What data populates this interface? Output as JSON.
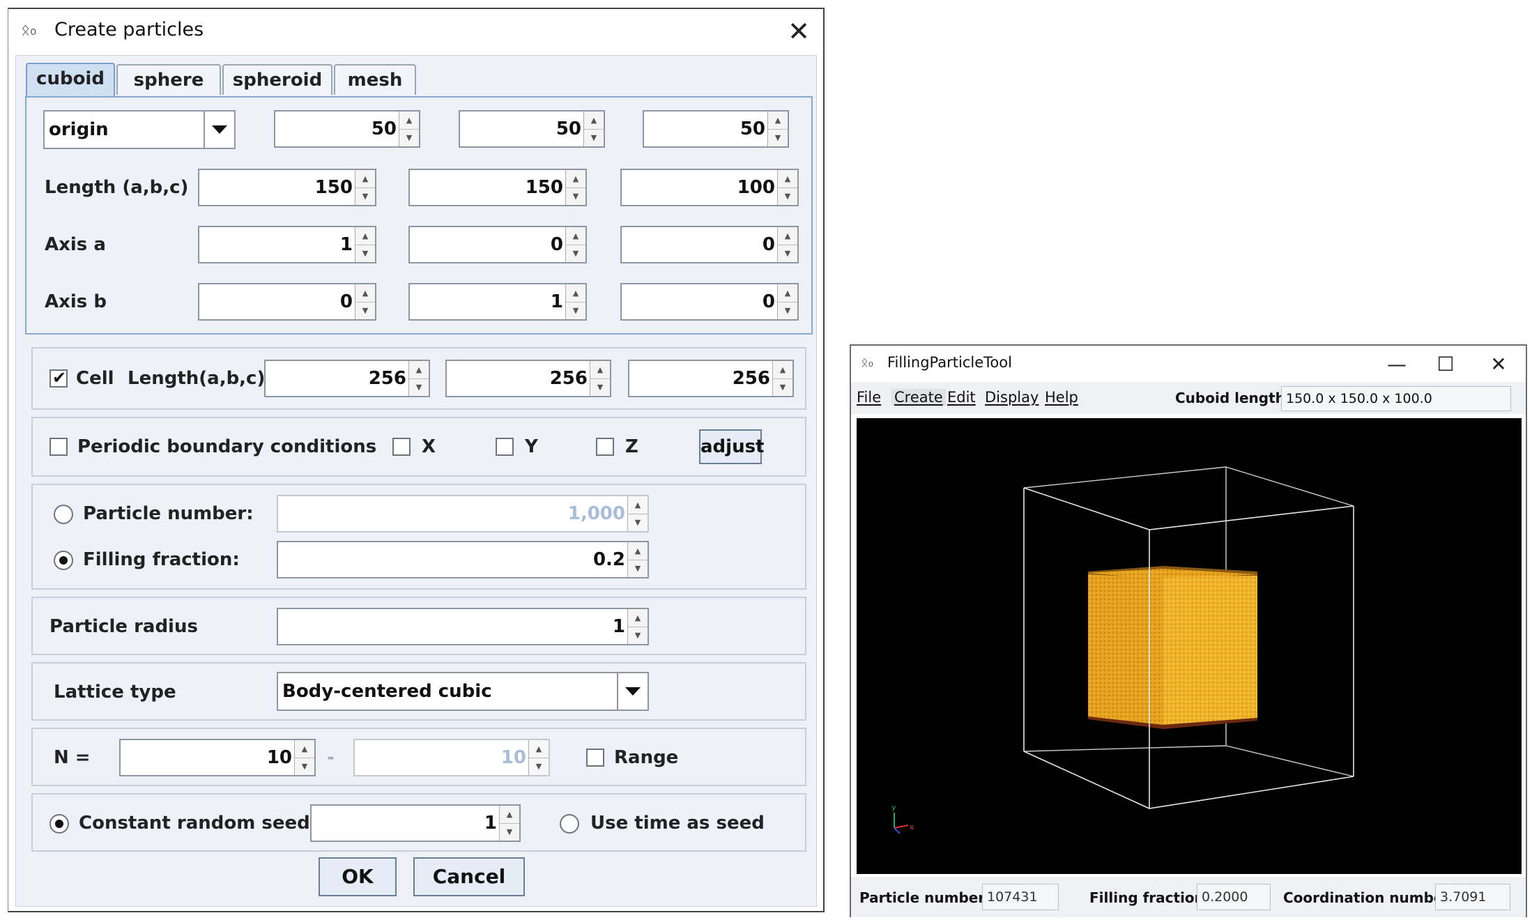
{
  "dialog": {
    "title": "Create particles",
    "close_glyph": "✕",
    "icon": "app-icon",
    "tabs": [
      "cuboid",
      "sphere",
      "spheroid",
      "mesh"
    ],
    "active_tab": "cuboid",
    "origin": {
      "select_value": "origin",
      "x": "50",
      "y": "50",
      "z": "50"
    },
    "length": {
      "label": "Length (a,b,c)",
      "a": "150",
      "b": "150",
      "c": "100"
    },
    "axis_a": {
      "label": "Axis a",
      "x": "1",
      "y": "0",
      "z": "0"
    },
    "axis_b": {
      "label": "Axis b",
      "x": "0",
      "y": "1",
      "z": "0"
    },
    "cell": {
      "checkbox_label": "Cell",
      "checked": true,
      "length_label": "Length(a,b,c)",
      "a": "256",
      "b": "256",
      "c": "256"
    },
    "pbc": {
      "label": "Periodic boundary conditions",
      "x_label": "X",
      "y_label": "Y",
      "z_label": "Z",
      "adjust_label": "adjust"
    },
    "particle_number": {
      "label": "Particle number:",
      "value": "1,000",
      "selected": false
    },
    "filling_fraction": {
      "label": "Filling fraction:",
      "value": "0.2",
      "selected": true
    },
    "particle_radius": {
      "label": "Particle radius",
      "value": "1"
    },
    "lattice": {
      "label": "Lattice type",
      "value": "Body-centered cubic"
    },
    "n": {
      "label": "N =",
      "value": "10",
      "dash": "-",
      "max_value": "10",
      "range_label": "Range"
    },
    "seed": {
      "constant_label": "Constant random seed",
      "value": "1",
      "time_label": "Use time as seed",
      "constant_selected": true
    },
    "ok_label": "OK",
    "cancel_label": "Cancel"
  },
  "main_window": {
    "title": "FillingParticleTool",
    "controls": {
      "minimize": "—",
      "maximize": "☐",
      "close": "✕"
    },
    "menu": [
      "File",
      "Create",
      "Edit",
      "Display",
      "Help"
    ],
    "cuboid_length_label": "Cuboid length :",
    "cuboid_length_value": "150.0 x 150.0 x 100.0",
    "status": {
      "particle_number_label": "Particle number:",
      "particle_number_value": "107431",
      "filling_fraction_label": "Filling fraction:",
      "filling_fraction_value": "0.2000",
      "coordination_label": "Coordination number:",
      "coordination_value": "3.7091"
    },
    "viewport": {
      "background": "#000000",
      "box_color": "#ffffff",
      "particle_color": "#f0b42a"
    }
  }
}
